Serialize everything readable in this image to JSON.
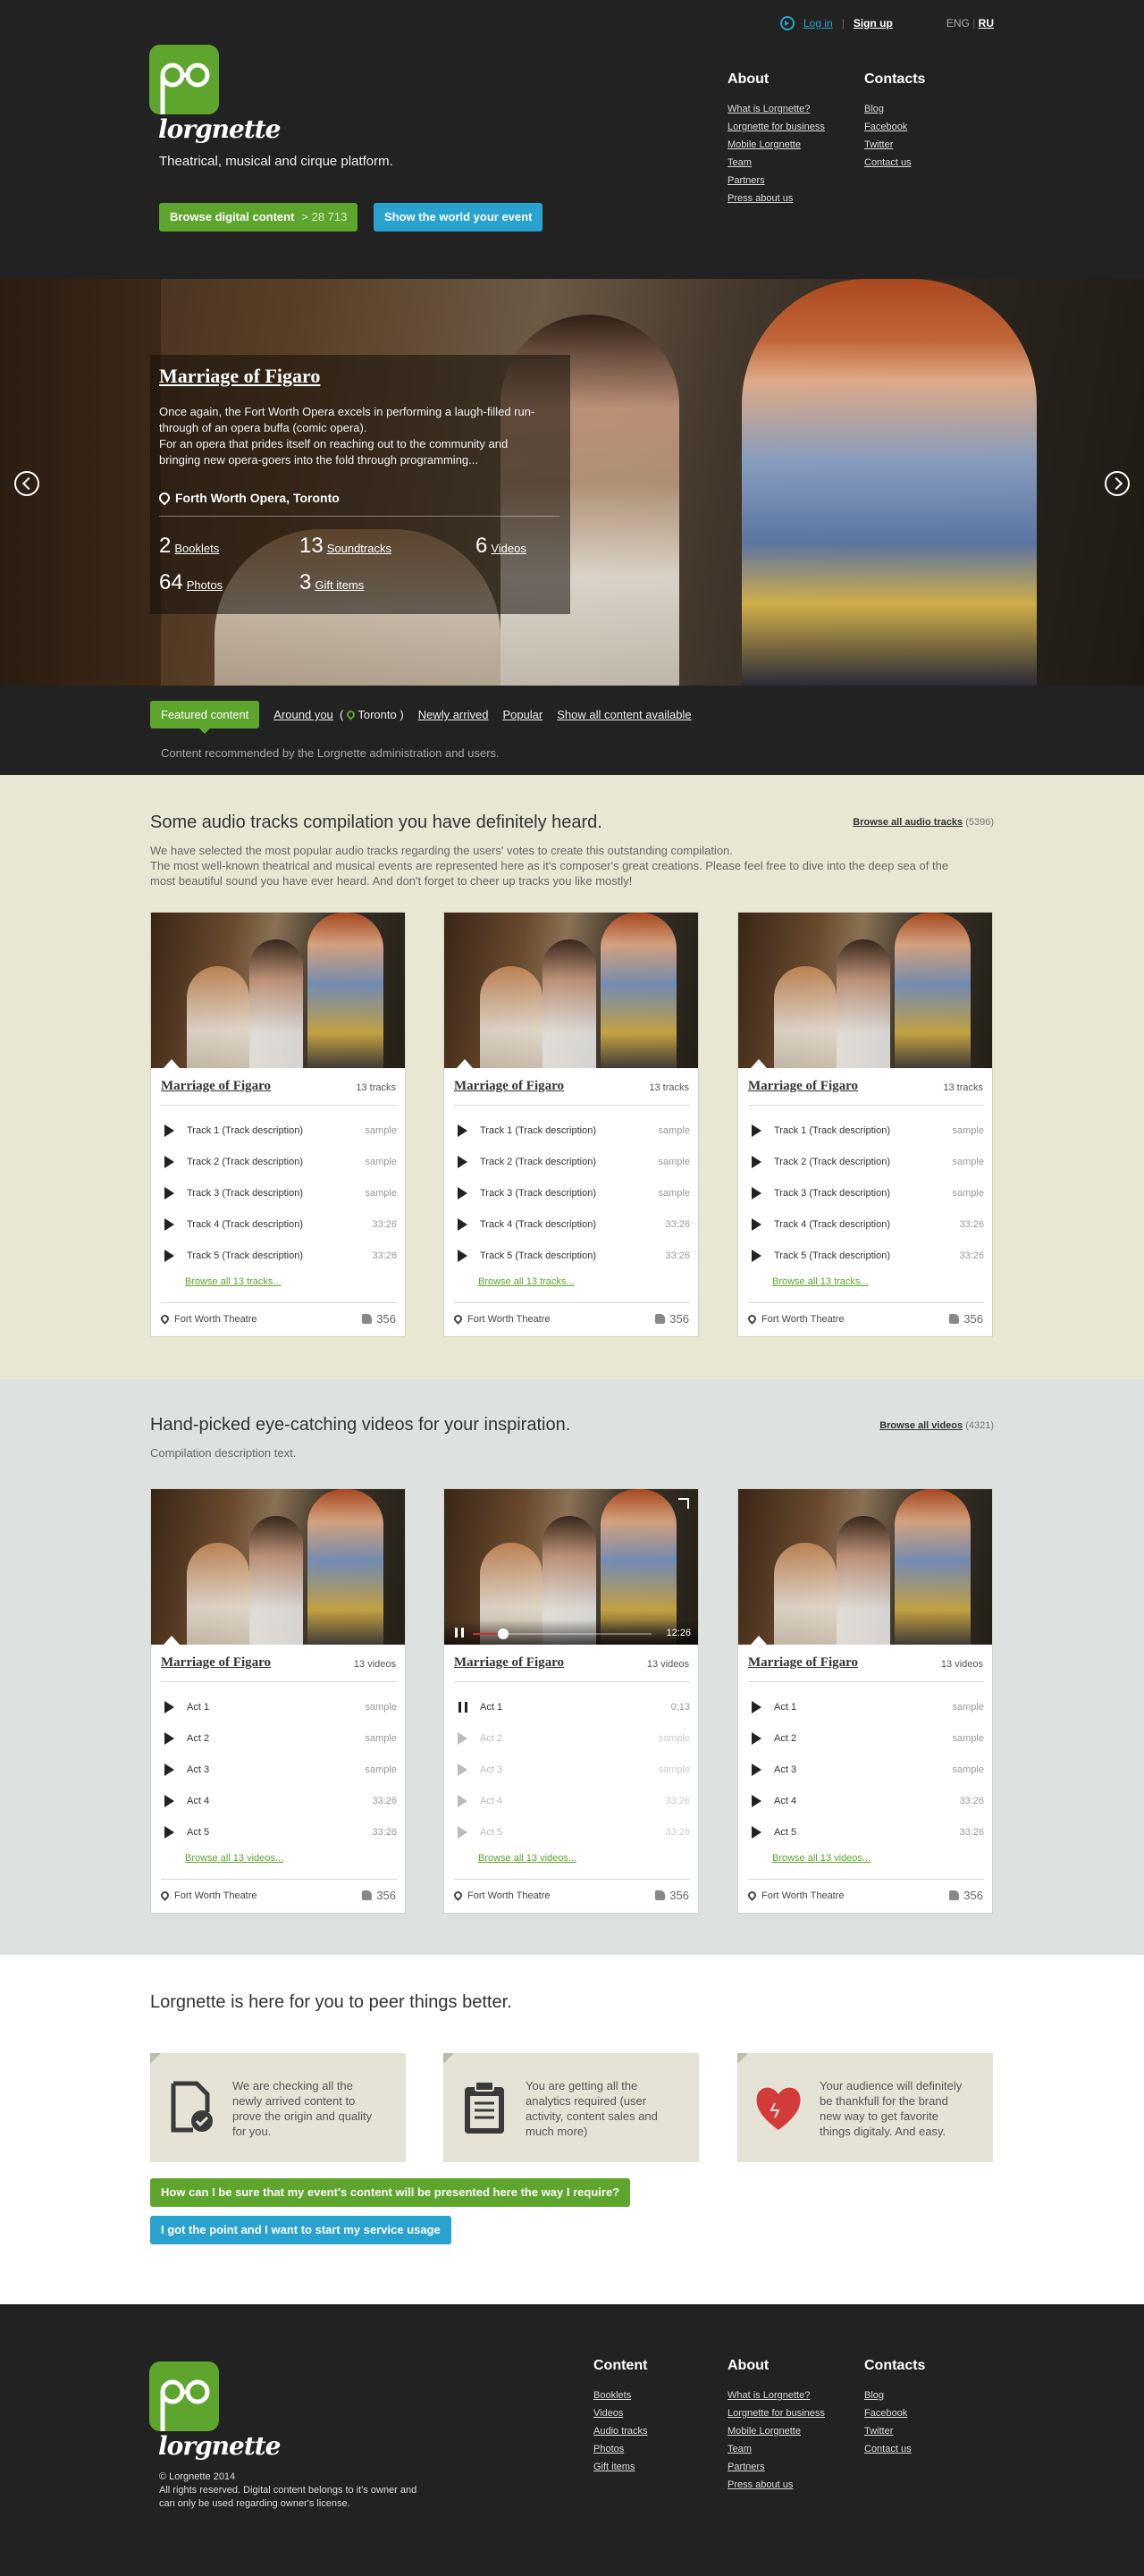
{
  "header": {
    "logo_text": "lorgnette",
    "tagline": "Theatrical, musical and cirque platform.",
    "browse_btn": "Browse digital content",
    "browse_count": "> 28 713",
    "show_btn": "Show the world your event",
    "login": "Log in",
    "signup": "Sign up",
    "lang_eng": "ENG",
    "lang_ru": "RU",
    "about": {
      "title": "About",
      "links": [
        "What is Lorgnette?",
        "Lorgnette for business",
        "Mobile Lorgnette",
        "Team",
        "Partners",
        "Press about us"
      ]
    },
    "contacts": {
      "title": "Contacts",
      "links": [
        "Blog",
        "Facebook",
        "Twitter",
        "Contact us"
      ]
    }
  },
  "hero": {
    "title": "Marriage of Figaro",
    "description": "Once again, the Fort Worth Opera excels in performing a laugh-filled run-through of an opera buffa (comic opera).\nFor an opera that prides itself on reaching out to the community and bringing new opera-goers into the fold through programming...",
    "location": "Forth Worth Opera, Toronto",
    "stats": [
      {
        "n": "2",
        "label": "Booklets"
      },
      {
        "n": "13",
        "label": "Soundtracks"
      },
      {
        "n": "6",
        "label": "Videos"
      },
      {
        "n": "64",
        "label": "Photos"
      },
      {
        "n": "3",
        "label": "Gift items"
      }
    ]
  },
  "filter": {
    "featured": "Featured content",
    "around": "Around you",
    "city": "Toronto",
    "newly": "Newly arrived",
    "popular": "Popular",
    "show_all": "Show all content available",
    "note": "Content recommended by the Lorgnette administration and users."
  },
  "audio": {
    "heading": "Some audio tracks compilation you have definitely heard.",
    "description": "We have selected the most popular audio tracks regarding the users' votes to create this outstanding compilation.\nThe most well-known theatrical and musical events are represented here as it's composer's great creations. Please feel free to dive into the deep sea of the most beautiful sound you have ever heard. And don't forget to cheer up tracks you like mostly!",
    "browse_all": "Browse all audio tracks",
    "browse_count": "(5396)",
    "cards": [
      {
        "title": "Marriage of Figaro",
        "count": "13 tracks",
        "browse": "Browse all 13 tracks...",
        "venue": "Fort Worth Theatre",
        "likes": "356",
        "items": [
          [
            "Track 1 (Track description)",
            "sample"
          ],
          [
            "Track 2 (Track description)",
            "sample"
          ],
          [
            "Track 3 (Track description)",
            "sample"
          ],
          [
            "Track 4 (Track description)",
            "33:26"
          ],
          [
            "Track 5 (Track description)",
            "33:26"
          ]
        ]
      },
      {
        "title": "Marriage of Figaro",
        "count": "13 tracks",
        "browse": "Browse all 13 tracks...",
        "venue": "Fort Worth Theatre",
        "likes": "356",
        "items": [
          [
            "Track 1 (Track description)",
            "sample"
          ],
          [
            "Track 2 (Track description)",
            "sample"
          ],
          [
            "Track 3 (Track description)",
            "sample"
          ],
          [
            "Track 4 (Track description)",
            "33:26"
          ],
          [
            "Track 5 (Track description)",
            "33:26"
          ]
        ]
      },
      {
        "title": "Marriage of Figaro",
        "count": "13 tracks",
        "browse": "Browse all 13 tracks...",
        "venue": "Fort Worth Theatre",
        "likes": "356",
        "items": [
          [
            "Track 1 (Track description)",
            "sample"
          ],
          [
            "Track 2 (Track description)",
            "sample"
          ],
          [
            "Track 3 (Track description)",
            "sample"
          ],
          [
            "Track 4 (Track description)",
            "33:26"
          ],
          [
            "Track 5 (Track description)",
            "33:26"
          ]
        ]
      }
    ]
  },
  "video": {
    "heading": "Hand-picked eye-catching videos for your inspiration.",
    "description": "Compilation description text.",
    "browse_all": "Browse all videos",
    "browse_count": "(4321)",
    "player_time": "12:26",
    "player_progress": 0.17,
    "cards": [
      {
        "title": "Marriage of Figaro",
        "count": "13 videos",
        "browse": "Browse all 13 videos...",
        "venue": "Fort Worth Theatre",
        "likes": "356",
        "items": [
          [
            "Act 1",
            "sample"
          ],
          [
            "Act 2",
            "sample"
          ],
          [
            "Act 3",
            "sample"
          ],
          [
            "Act 4",
            "33:26"
          ],
          [
            "Act 5",
            "33:26"
          ]
        ]
      },
      {
        "title": "Marriage of Figaro",
        "count": "13 videos",
        "browse": "Browse all 13 videos...",
        "venue": "Fort Worth Theatre",
        "likes": "356",
        "items": [
          [
            "Act 1",
            "0:13"
          ],
          [
            "Act 2",
            "sample"
          ],
          [
            "Act 3",
            "sample"
          ],
          [
            "Act 4",
            "33:26"
          ],
          [
            "Act 5",
            "33:26"
          ]
        ]
      },
      {
        "title": "Marriage of Figaro",
        "count": "13 videos",
        "browse": "Browse all 13 videos...",
        "venue": "Fort Worth Theatre",
        "likes": "356",
        "items": [
          [
            "Act 1",
            "sample"
          ],
          [
            "Act 2",
            "sample"
          ],
          [
            "Act 3",
            "sample"
          ],
          [
            "Act 4",
            "33:26"
          ],
          [
            "Act 5",
            "33:26"
          ]
        ]
      }
    ]
  },
  "features": {
    "heading": "Lorgnette is here for you to peer things better.",
    "items": [
      {
        "icon": "document-check-icon",
        "text": "We are checking all the newly arrived content to prove the origin and quality for you."
      },
      {
        "icon": "clipboard-icon",
        "text": "You are getting all the analytics required (user activity, content sales and much more)"
      },
      {
        "icon": "heart-icon",
        "text": "Your audience will definitely be thankfull for the brand new way to get favorite things digitaly. And easy."
      }
    ],
    "btn_question": "How can I be sure that my event's content will be presented here the way I require?",
    "btn_start": "I got the point and I want to start my service usage"
  },
  "footer": {
    "logo_text": "lorgnette",
    "copyright": "© Lorgnette 2014",
    "rights": "All rights reserved. Digital content belongs to it's owner and can only be used regarding owner's license.",
    "content": {
      "title": "Content",
      "links": [
        "Booklets",
        "Videos",
        "Audio tracks",
        "Photos",
        "Gift items"
      ]
    },
    "about": {
      "title": "About",
      "links": [
        "What is Lorgnette?",
        "Lorgnette for business",
        "Mobile Lorgnette",
        "Team",
        "Partners",
        "Press about us"
      ]
    },
    "contacts": {
      "title": "Contacts",
      "links": [
        "Blog",
        "Facebook",
        "Twitter",
        "Contact us"
      ]
    }
  },
  "colors": {
    "brand_green": "#5ea52e",
    "brand_blue": "#2aa2cf",
    "dark": "#222222",
    "audio_bg": "#e7e7d3",
    "video_bg": "#dde2e1",
    "heart_red": "#d33a3a"
  }
}
